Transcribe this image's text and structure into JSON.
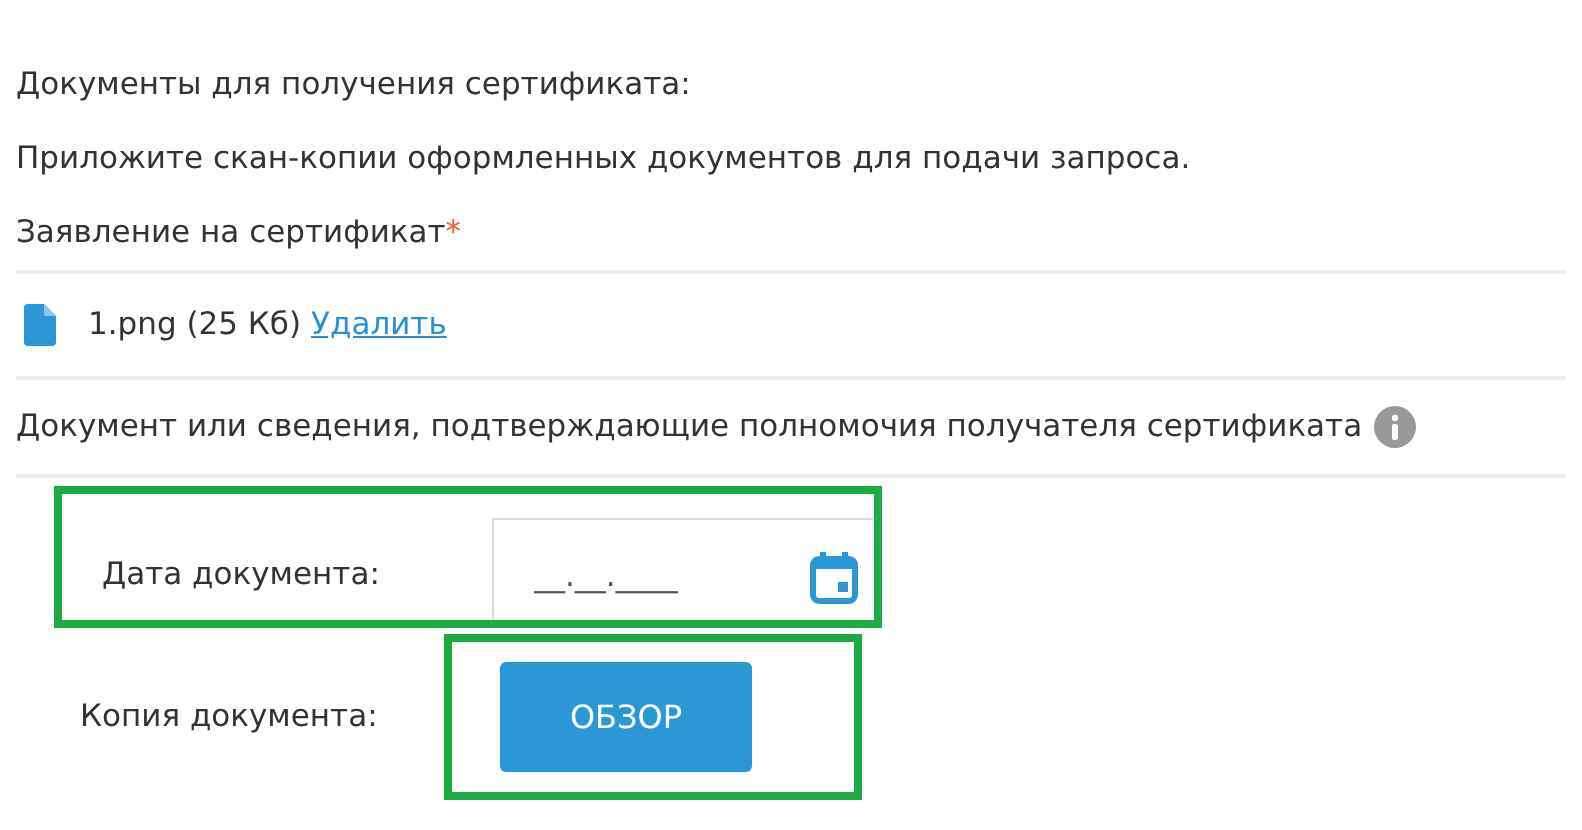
{
  "heading": "Документы для получения сертификата:",
  "instruction": "Приложите скан-копии оформленных документов для подачи запроса.",
  "application": {
    "label": "Заявление на сертификат",
    "required_mark": "*",
    "file": {
      "name": "1.png (25 Кб)",
      "delete_link": "Удалить"
    }
  },
  "authority": {
    "label": "Документ или сведения, подтверждающие полномочия получателя сертификата",
    "info": true
  },
  "fields": [
    {
      "kind": "date",
      "label": "Дата документа:",
      "placeholder": "__.__.____",
      "highlighted": true
    },
    {
      "kind": "file",
      "label": "Копия документа:",
      "button": "ОБЗОР",
      "highlighted": true
    }
  ]
}
